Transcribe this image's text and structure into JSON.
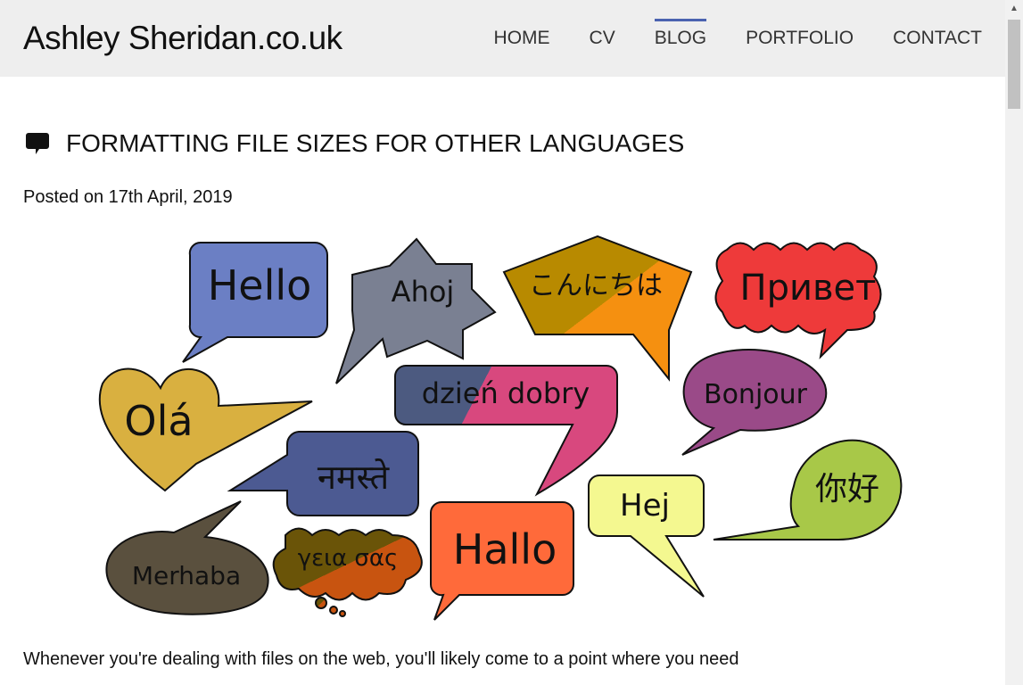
{
  "header": {
    "logo": "Ashley Sheridan.co.uk",
    "nav": [
      {
        "label": "HOME"
      },
      {
        "label": "CV"
      },
      {
        "label": "BLOG",
        "active": true
      },
      {
        "label": "PORTFOLIO"
      },
      {
        "label": "CONTACT"
      }
    ],
    "accent": "#4a62b0"
  },
  "post": {
    "icon": "speech-bubble-icon",
    "title": "FORMATTING FILE SIZES FOR OTHER LANGUAGES",
    "posted": "Posted on 17th April, 2019",
    "intro": "Whenever you're dealing with files on the web, you'll likely come to a point where you need"
  },
  "image": {
    "greetings": [
      "Hello",
      "Ahoj",
      "こんにちは",
      "Привет",
      "Olá",
      "dzień dobry",
      "Bonjour",
      "नमस्ते",
      "你好",
      "Hej",
      "Merhaba",
      "γεια σας",
      "Hallo"
    ]
  }
}
